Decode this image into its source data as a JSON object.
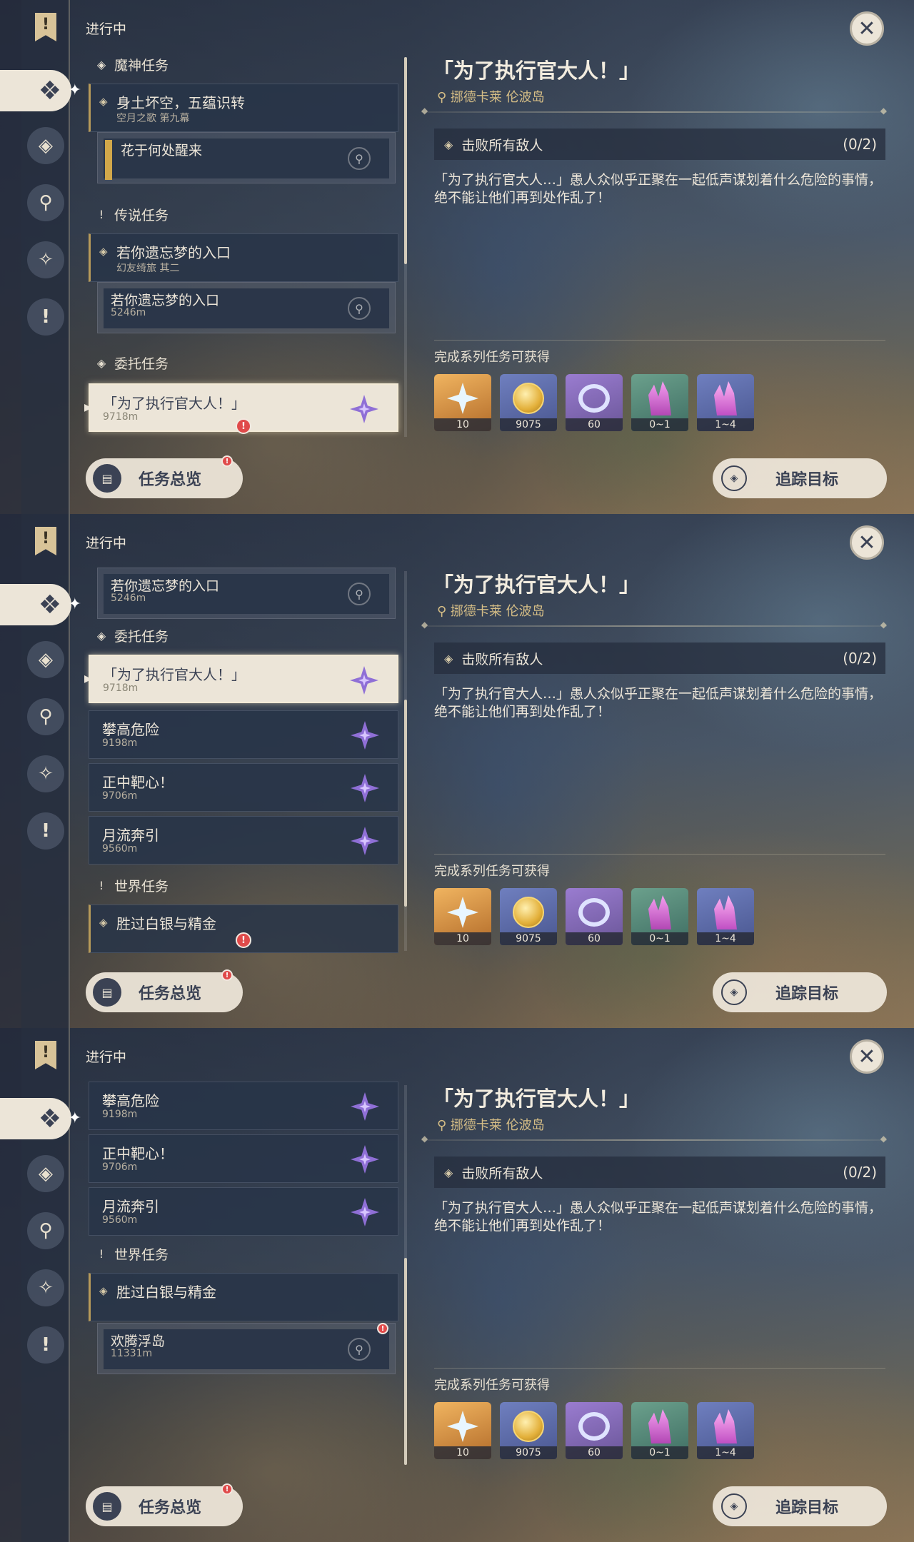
{
  "in_progress_label": "进行中",
  "categories": {
    "archon": "魔神任务",
    "story": "传说任务",
    "commission": "委托任务",
    "world": "世界任务"
  },
  "quests": {
    "archon_main": {
      "title": "身土坏空，五蕴识转",
      "subtitle": "空月之歌 第九幕"
    },
    "archon_sub": {
      "title": "花于何处醒来"
    },
    "story_main": {
      "title": "若你遗忘梦的入口",
      "subtitle": "幻友绮旅 其二"
    },
    "story_sub": {
      "title": "若你遗忘梦的入口",
      "distance": "5246m"
    },
    "commission_1": {
      "title": "「为了执行官大人！」",
      "distance": "9718m"
    },
    "commission_2": {
      "title": "攀高危险",
      "distance": "9198m"
    },
    "commission_3": {
      "title": "正中靶心！",
      "distance": "9706m"
    },
    "commission_4": {
      "title": "月流奔引",
      "distance": "9560m"
    },
    "world_main": {
      "title": "胜过白银与精金"
    },
    "world_sub": {
      "title": "欢腾浮岛",
      "distance": "11331m"
    }
  },
  "buttons": {
    "overview": "任务总览",
    "track": "追踪目标"
  },
  "detail": {
    "title": "「为了执行官大人！」",
    "location": "挪德卡莱 伦波岛",
    "objective": "击败所有敌人",
    "objective_count": "(0/2)",
    "description": "「为了执行官大人…」愚人众似乎正聚在一起低声谋划着什么危险的事情，绝不能让他们再到处作乱了！",
    "rewards_label": "完成系列任务可获得",
    "rewards": [
      {
        "icon": "primogem-icon",
        "count": "10"
      },
      {
        "icon": "mora-icon",
        "count": "9075"
      },
      {
        "icon": "companionship-exp-icon",
        "count": "60"
      },
      {
        "icon": "crystal-chunk-icon",
        "count": "0~1"
      },
      {
        "icon": "crystal-cluster-icon",
        "count": "1~4"
      }
    ]
  },
  "colors": {
    "panel_text": "#ece5d8",
    "selected_bg": "#ece5d8",
    "location_gold": "#d6be86",
    "alert_red": "#e04a4a",
    "commission_purple": "#8f6fd6"
  }
}
